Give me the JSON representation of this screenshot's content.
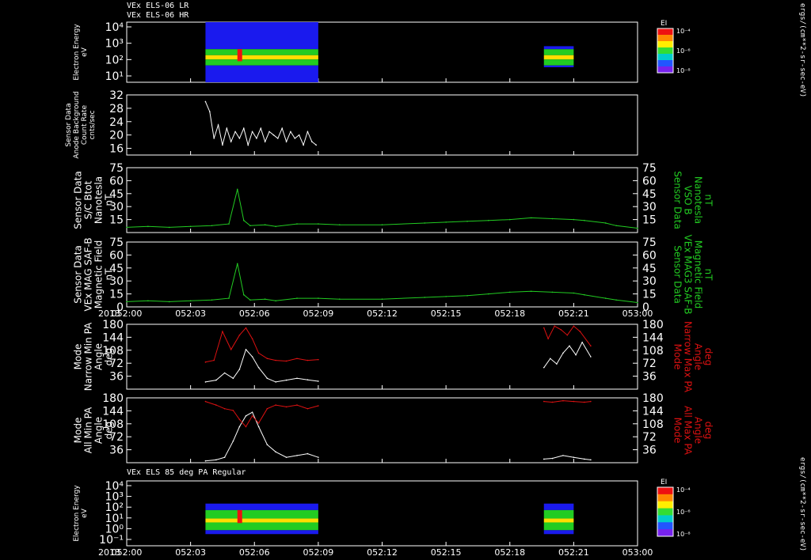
{
  "header": {
    "line1": "VEx ELS-06 LR",
    "line2": "VEx ELS-06 HR",
    "bottom_title": "VEx ELS 85 deg PA Regular"
  },
  "colorbar": {
    "label": "EI",
    "ticks": [
      "10⁻⁴",
      "10⁻⁶",
      "10⁻⁸"
    ],
    "units": "ergs/(cm**2-sr-sec-eV)"
  },
  "time_axis": {
    "year": "2013",
    "ticks": [
      "052:00",
      "052:03",
      "052:06",
      "052:09",
      "052:12",
      "052:15",
      "052:18",
      "052:21",
      "053:00"
    ]
  },
  "colors": {
    "trace_white": "#ffffff",
    "trace_green": "#22cc22",
    "trace_red": "#dd1111",
    "label_green": "#22cc22",
    "label_red": "#dd1111"
  },
  "chart_data": [
    {
      "id": "p1",
      "type": "heatmap",
      "left_label": [
        "Electron Energy",
        "eV"
      ],
      "yticks": [
        "10⁴",
        "10³",
        "10²",
        "10¹"
      ],
      "data_intervals": [
        [
          "052:03:40",
          "052:09:00"
        ],
        [
          "052:19:40",
          "052:21:00"
        ]
      ]
    },
    {
      "id": "p2",
      "type": "line",
      "left_label": [
        "Sensor Data",
        "Anode Background",
        "Count Rate",
        "cnts/sec"
      ],
      "yticks": [
        "32",
        "28",
        "24",
        "20",
        "16"
      ],
      "ylim": [
        14,
        32
      ],
      "series": [
        {
          "color": "white",
          "x": [
            3.7,
            3.9,
            4.1,
            4.3,
            4.5,
            4.7,
            4.9,
            5.1,
            5.3,
            5.5,
            5.7,
            5.9,
            6.1,
            6.3,
            6.5,
            6.7,
            6.9,
            7.1,
            7.3,
            7.5,
            7.7,
            7.9,
            8.1,
            8.3,
            8.5,
            8.7,
            8.9
          ],
          "y": [
            30,
            27,
            19,
            23,
            17,
            22,
            18,
            21,
            19,
            22,
            17,
            21,
            19,
            22,
            18,
            21,
            20,
            19,
            22,
            18,
            21,
            19,
            20,
            17,
            21,
            18,
            17
          ]
        }
      ]
    },
    {
      "id": "p3",
      "type": "line",
      "left_label": [
        "Sensor Data",
        "S/C Btot",
        "Nanotesla",
        "nT"
      ],
      "right_label": [
        "Sensor Data",
        "VSO B",
        "Nanotesla",
        "nT"
      ],
      "yticks": [
        "75",
        "60",
        "45",
        "30",
        "15"
      ],
      "right_yticks": [
        "75",
        "60",
        "45",
        "30",
        "15"
      ],
      "ylim": [
        0,
        75
      ],
      "series": [
        {
          "color": "green",
          "x": [
            0,
            1,
            2,
            3,
            4,
            4.8,
            5.2,
            5.5,
            5.8,
            6.5,
            7,
            8,
            9,
            10,
            12,
            14,
            15,
            16,
            17,
            18,
            19,
            20,
            21,
            21.5,
            22.5,
            23,
            24
          ],
          "y": [
            6,
            7,
            6,
            7,
            8,
            10,
            50,
            14,
            8,
            9,
            7,
            10,
            10,
            9,
            9,
            11,
            12,
            13,
            14,
            15,
            17,
            16,
            15,
            14,
            11,
            8,
            5
          ]
        }
      ]
    },
    {
      "id": "p4",
      "type": "line",
      "left_label": [
        "Sensor Data",
        "VEx MAG SAF-B",
        "Magnetic Field",
        "nT"
      ],
      "right_label": [
        "Sensor Data",
        "VEx MAG3 SAF-B",
        "Magnetic Field",
        "nT"
      ],
      "yticks": [
        "75",
        "60",
        "45",
        "30",
        "15",
        "0"
      ],
      "right_yticks": [
        "75",
        "60",
        "45",
        "30",
        "15",
        "0"
      ],
      "ylim": [
        0,
        75
      ],
      "series": [
        {
          "color": "green",
          "x": [
            0,
            1,
            2,
            3,
            4,
            4.8,
            5.2,
            5.5,
            5.8,
            6.5,
            7,
            8,
            9,
            10,
            12,
            14,
            15,
            16,
            17,
            18,
            19,
            20,
            21,
            21.5,
            22.5,
            23,
            24
          ],
          "y": [
            6,
            7,
            6,
            7,
            8,
            10,
            50,
            14,
            8,
            9,
            7,
            10,
            10,
            9,
            9,
            11,
            12,
            13,
            15,
            17,
            18,
            17,
            16,
            14,
            10,
            8,
            5
          ]
        }
      ]
    },
    {
      "id": "p5",
      "type": "line",
      "left_label": [
        "Mode",
        "Narrow Min PA",
        "Angle",
        "deg"
      ],
      "right_label": [
        "Mode",
        "Narrow Max PA",
        "Angle",
        "deg"
      ],
      "yticks": [
        "180",
        "144",
        "108",
        "72",
        "36"
      ],
      "right_yticks": [
        "180",
        "144",
        "108",
        "72",
        "36"
      ],
      "ylim": [
        0,
        180
      ],
      "series": [
        {
          "color": "white",
          "x": [
            3.7,
            4.2,
            4.6,
            5.0,
            5.3,
            5.6,
            5.9,
            6.2,
            6.6,
            7.0,
            7.5,
            8.0,
            8.5,
            9.0,
            19.6,
            19.9,
            20.2,
            20.5,
            20.8,
            21.1,
            21.4,
            21.8
          ],
          "y": [
            20,
            25,
            45,
            30,
            55,
            110,
            90,
            60,
            30,
            20,
            25,
            30,
            26,
            22,
            60,
            85,
            70,
            100,
            120,
            95,
            130,
            90
          ]
        },
        {
          "color": "red",
          "x": [
            3.7,
            4.1,
            4.5,
            4.9,
            5.3,
            5.6,
            5.9,
            6.2,
            6.6,
            7.0,
            7.5,
            8.0,
            8.5,
            9.0,
            19.6,
            19.8,
            20.1,
            20.4,
            20.7,
            21.0,
            21.3,
            21.8
          ],
          "y": [
            75,
            80,
            160,
            110,
            150,
            170,
            140,
            100,
            85,
            80,
            78,
            85,
            80,
            82,
            170,
            140,
            175,
            165,
            150,
            175,
            160,
            120
          ]
        }
      ]
    },
    {
      "id": "p6",
      "type": "line",
      "left_label": [
        "Mode",
        "All Min PA",
        "Angle",
        "deg"
      ],
      "right_label": [
        "Mode",
        "All Max PA",
        "Angle",
        "deg"
      ],
      "yticks": [
        "180",
        "144",
        "108",
        "72",
        "36"
      ],
      "right_yticks": [
        "180",
        "144",
        "108",
        "72",
        "36"
      ],
      "ylim": [
        0,
        180
      ],
      "series": [
        {
          "color": "white",
          "x": [
            3.7,
            4.2,
            4.6,
            5.0,
            5.3,
            5.6,
            5.9,
            6.2,
            6.6,
            7.0,
            7.5,
            8.0,
            8.5,
            9.0,
            19.6,
            20.0,
            20.5,
            21.0,
            21.5,
            21.8
          ],
          "y": [
            5,
            8,
            15,
            60,
            100,
            130,
            140,
            100,
            50,
            30,
            15,
            20,
            25,
            15,
            10,
            12,
            20,
            15,
            10,
            8
          ]
        },
        {
          "color": "red",
          "x": [
            3.7,
            4.2,
            4.6,
            5.0,
            5.3,
            5.6,
            5.9,
            6.2,
            6.6,
            7.0,
            7.5,
            8.0,
            8.5,
            9.0,
            19.6,
            20.0,
            20.5,
            21.0,
            21.5,
            21.8
          ],
          "y": [
            170,
            160,
            150,
            145,
            120,
            100,
            130,
            110,
            150,
            160,
            155,
            160,
            150,
            158,
            170,
            168,
            172,
            170,
            168,
            170
          ]
        }
      ]
    },
    {
      "id": "p7",
      "type": "heatmap",
      "left_label": [
        "Electron Energy",
        "eV"
      ],
      "yticks": [
        "10⁴",
        "10³",
        "10²",
        "10¹",
        "10⁰",
        "10⁻¹"
      ],
      "data_intervals": [
        [
          "052:03:40",
          "052:09:00"
        ],
        [
          "052:19:40",
          "052:21:00"
        ]
      ]
    }
  ]
}
